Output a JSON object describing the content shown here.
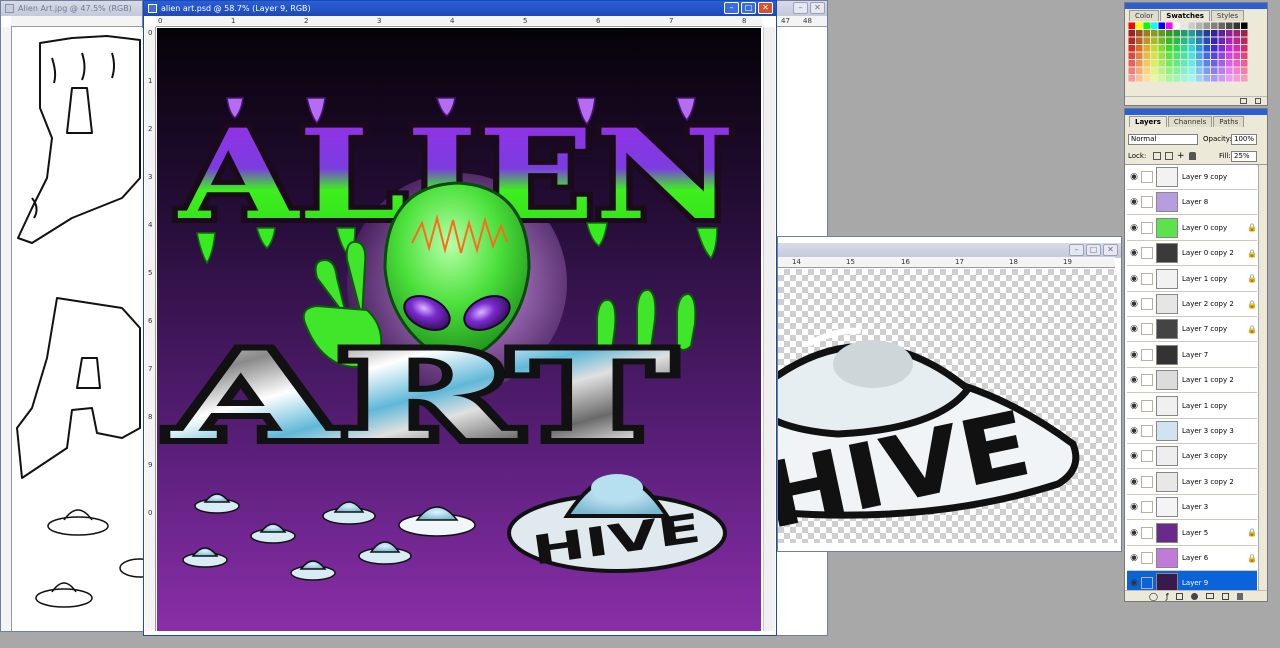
{
  "windows": {
    "left_doc": {
      "title": "Alien Art.jpg @ 47.5% (RGB)"
    },
    "main_doc": {
      "title": "alien art.psd @ 58.7% (Layer 9, RGB)",
      "ruler_top": [
        "0",
        "1",
        "2",
        "3",
        "4",
        "5",
        "6",
        "7",
        "8"
      ],
      "ruler_left": [
        "0",
        "1",
        "2",
        "3",
        "4",
        "5",
        "6",
        "7",
        "8",
        "9",
        "0"
      ]
    },
    "right_doc": {
      "ruler_top": [
        "14",
        "15",
        "16",
        "17",
        "18",
        "19"
      ],
      "ruler_partial": [
        "47",
        "48"
      ]
    }
  },
  "artwork": {
    "title_word": "ALIEN",
    "sub_word": "ART",
    "ufo_text": "HIVE"
  },
  "colors": {
    "slime_green": "#35f01e",
    "slime_purple": "#8f2be0",
    "space_dark": "#1a0a2a",
    "space_purple": "#7a2a9a",
    "selected_layer": "#0a63d8"
  },
  "swatches_panel": {
    "tabs": [
      "Color",
      "Swatches",
      "Styles"
    ],
    "active_tab": "Swatches"
  },
  "layers_panel": {
    "tabs": [
      "Layers",
      "Channels",
      "Paths"
    ],
    "active_tab": "Layers",
    "blend_mode": "Normal",
    "opacity_label": "Opacity:",
    "opacity_value": "100%",
    "lock_label": "Lock:",
    "fill_label": "Fill:",
    "fill_value": "25%",
    "layers": [
      {
        "name": "Layer 9 copy",
        "locked": false,
        "thumb": "#f2f2f2"
      },
      {
        "name": "Layer 8",
        "locked": false,
        "thumb": "#b99be0"
      },
      {
        "name": "Layer 0 copy",
        "locked": true,
        "thumb": "#5ce24a"
      },
      {
        "name": "Layer 0 copy 2",
        "locked": true,
        "thumb": "#3a3a3a"
      },
      {
        "name": "Layer 1 copy",
        "locked": true,
        "thumb": "#f2f2f2"
      },
      {
        "name": "Layer 2 copy 2",
        "locked": true,
        "thumb": "#e6e6e6"
      },
      {
        "name": "Layer 7 copy",
        "locked": true,
        "thumb": "#444444"
      },
      {
        "name": "Layer 7",
        "locked": false,
        "thumb": "#333333"
      },
      {
        "name": "Layer 1 copy 2",
        "locked": false,
        "thumb": "#dcdcdc"
      },
      {
        "name": "Layer 1 copy",
        "locked": false,
        "thumb": "#f0f0f0"
      },
      {
        "name": "Layer 3 copy 3",
        "locked": false,
        "thumb": "#cfe4f0"
      },
      {
        "name": "Layer 3 copy",
        "locked": false,
        "thumb": "#eeeeee"
      },
      {
        "name": "Layer 3 copy 2",
        "locked": false,
        "thumb": "#e8e8e8"
      },
      {
        "name": "Layer 3",
        "locked": false,
        "thumb": "#f4f4f4"
      },
      {
        "name": "Layer 5",
        "locked": true,
        "thumb": "#6a2a8a"
      },
      {
        "name": "Layer 6",
        "locked": true,
        "thumb": "#c07ad8"
      },
      {
        "name": "Layer 9",
        "locked": false,
        "thumb": "#3a1a4a",
        "selected": true
      }
    ]
  }
}
